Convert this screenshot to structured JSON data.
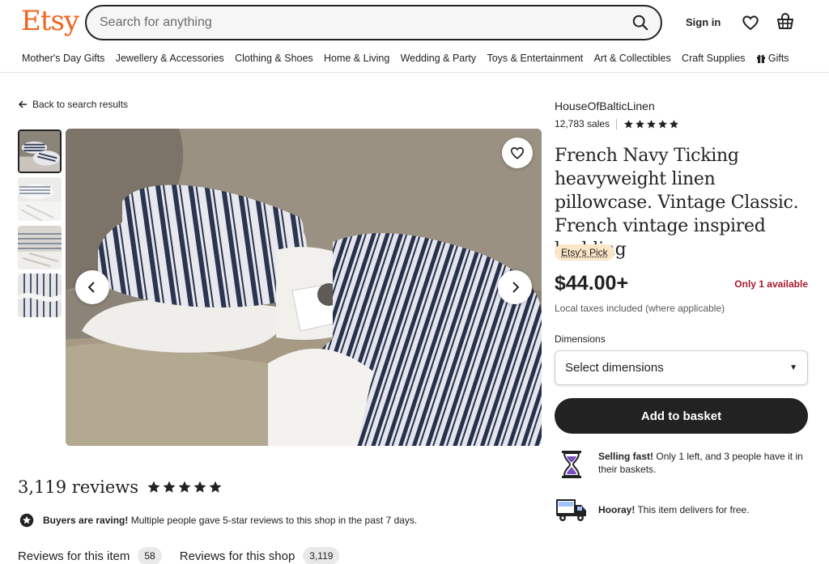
{
  "header": {
    "logo": "Etsy",
    "search_placeholder": "Search for anything",
    "signin_label": "Sign in"
  },
  "categories": [
    "Mother's Day Gifts",
    "Jewellery & Accessories",
    "Clothing & Shoes",
    "Home & Living",
    "Wedding & Party",
    "Toys & Entertainment",
    "Art & Collectibles",
    "Craft Supplies",
    "Gifts"
  ],
  "back_link": "Back to search results",
  "gallery": {
    "thumbnail_count": 4,
    "active_index": 0
  },
  "product": {
    "shop_name": "HouseOfBalticLinen",
    "sales": "12,783 sales",
    "shop_rating_stars": 5,
    "title": "French Navy Ticking heavyweight linen pillowcase. Vintage Classic. French vintage inspired bedding",
    "badge": "Etsy's Pick",
    "price": "$44.00+",
    "availability": "Only 1 available",
    "taxes_note": "Local taxes included (where applicable)",
    "dimensions_label": "Dimensions",
    "dimensions_selected": "Select dimensions",
    "add_button": "Add to basket"
  },
  "features": {
    "selling_fast_title": "Selling fast!",
    "selling_fast_text": "Only 1 left, and 3 people have it in their baskets.",
    "delivery_title": "Hooray!",
    "delivery_text": "This item delivers for free."
  },
  "reviews": {
    "title": "3,119 reviews",
    "rating_stars": 5,
    "raving_title": "Buyers are raving!",
    "raving_text": "Multiple people gave 5-star reviews to this shop in the past 7 days.",
    "tab_item_label": "Reviews for this item",
    "tab_item_count": "58",
    "tab_shop_label": "Reviews for this shop",
    "tab_shop_count": "3,119"
  },
  "colors": {
    "brand": "#f1641e",
    "availability": "#a61a2e",
    "badge_bg": "#fbe6c8",
    "button_bg": "#222222"
  }
}
